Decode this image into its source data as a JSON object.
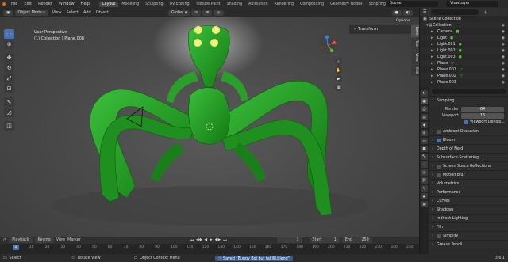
{
  "topbar": {
    "menu": [
      "File",
      "Edit",
      "Render",
      "Window",
      "Help"
    ],
    "workspaces": [
      "Layout",
      "Modeling",
      "Sculpting",
      "UV Editing",
      "Texture Paint",
      "Shading",
      "Animation",
      "Rendering",
      "Compositing",
      "Geometry Nodes",
      "Scripting"
    ],
    "active_workspace": "Layout",
    "scene": "Scene",
    "view_layer": "ViewLayer"
  },
  "viewport": {
    "mode": "Object Mode",
    "menu": [
      "View",
      "Select",
      "Add",
      "Object"
    ],
    "transform_orientation": "Global",
    "info_line1": "User Perspective",
    "info_line2": "(1) Collection | Plane.008",
    "options_label": "Options",
    "npanel_section": "Transform",
    "npanel_tabs": [
      "Item",
      "Tool",
      "View",
      "Edit"
    ]
  },
  "timeline": {
    "menu": [
      "Playback",
      "Keying",
      "View",
      "Marker"
    ],
    "current_frame": "1",
    "start_label": "Start",
    "start": "1",
    "end_label": "End",
    "end": "250",
    "ruler": [
      "0",
      "10",
      "20",
      "30",
      "40",
      "50",
      "60",
      "70",
      "80",
      "90",
      "100",
      "110",
      "120",
      "130",
      "140",
      "150",
      "160",
      "170",
      "180",
      "190",
      "200",
      "210",
      "220",
      "230",
      "240",
      "250"
    ]
  },
  "statusbar": {
    "select": "Select",
    "rotate": "Rotate View",
    "context": "Object Context Menu",
    "message": "Saved \"Buggy Boi but tallllll.blend\"",
    "version": "3.6.1"
  },
  "outliner": {
    "root": "Scene Collection",
    "items": [
      "Collection",
      "Camera",
      "Light",
      "Light.001",
      "Light.002",
      "Light.003",
      "Plane",
      "Plane.001",
      "Plane.002",
      "Plane.003"
    ]
  },
  "properties": {
    "sections": {
      "sampling": "Sampling",
      "render_label": "Render",
      "render_value": "64",
      "viewport_label": "Viewport",
      "viewport_value": "16",
      "viewport_denoise": "Viewport Denois...",
      "ambient_occlusion": "Ambient Occlusion",
      "bloom": "Bloom",
      "depth_of_field": "Depth of Field",
      "subsurface": "Subsurface Scattering",
      "ssr": "Screen Space Reflections",
      "motion_blur": "Motion Blur",
      "volumetrics": "Volumetrics",
      "performance": "Performance",
      "curves": "Curves",
      "shadows": "Shadows",
      "indirect": "Indirect Lighting",
      "film": "Film",
      "simplify": "Simplify",
      "grease_pencil": "Grease Pencil"
    }
  },
  "colors": {
    "accent": "#4772b3",
    "creature": "#2a9a2a",
    "eyes": "#f2f27a"
  }
}
